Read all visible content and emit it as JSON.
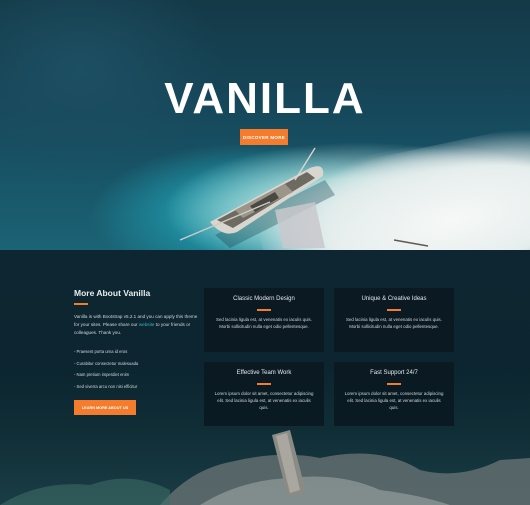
{
  "hero": {
    "title": "VANILLA",
    "button_label": "DISCOVER MORE"
  },
  "about": {
    "title": "More About Vanilla",
    "intro_before_link": "Vanilla is with Bootstrap v5.2.1 and you can apply this theme for your sites. Please share our ",
    "intro_link": "website",
    "intro_after_link": " to your friends or colleagues. Thank you.",
    "bullets": [
      "- Praesent porta urna id eros",
      "- Curabitur consectetur malesuada",
      "- Nam pretium imperdiet enim",
      "- Sed viverra arcu non nisi efficitur"
    ],
    "button_label": "LEARN MORE ABOUT US"
  },
  "cards": [
    {
      "title": "Classic Modern Design",
      "text": "Sed lacinia ligula est, at venenatis ex iaculis quis. Morbi sollicitudin nulla eget odio pellentesque."
    },
    {
      "title": "Unique & Creative Ideas",
      "text": "Sed lacinia ligula est, at venenatis ex iaculis quis. Morbi sollicitudin nulla eget odio pellentesque."
    },
    {
      "title": "Effective Team Work",
      "text": "Lorem ipsum dolor sit amet, consectetur adipiscing elit. Sed lacinia ligula est, at venenatis ex iaculis quis."
    },
    {
      "title": "Fast Support 24/7",
      "text": "Lorem ipsum dolor sit amet, consectetur adipiscing elit. Sed lacinia ligula est, at venenatis ex iaculis quis."
    }
  ],
  "colors": {
    "accent": "#f47c2c",
    "link": "#36b6c9",
    "section_bg": "#0c2530"
  }
}
